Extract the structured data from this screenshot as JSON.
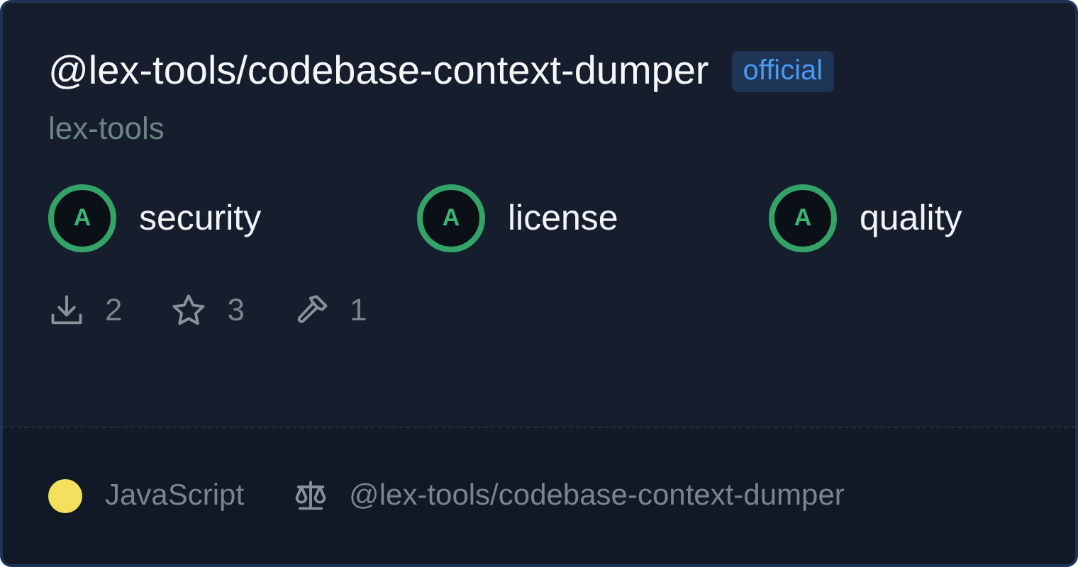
{
  "package": {
    "name": "@lex-tools/codebase-context-dumper",
    "badge": "official",
    "owner": "lex-tools"
  },
  "scores": [
    {
      "grade": "A",
      "label": "security"
    },
    {
      "grade": "A",
      "label": "license"
    },
    {
      "grade": "A",
      "label": "quality"
    }
  ],
  "stats": [
    {
      "kind": "downloads",
      "value": "2"
    },
    {
      "kind": "stars",
      "value": "3"
    },
    {
      "kind": "tools",
      "value": "1"
    }
  ],
  "footer": {
    "language": {
      "name": "JavaScript",
      "color": "#f2e05e"
    },
    "license": "@lex-tools/codebase-context-dumper"
  }
}
